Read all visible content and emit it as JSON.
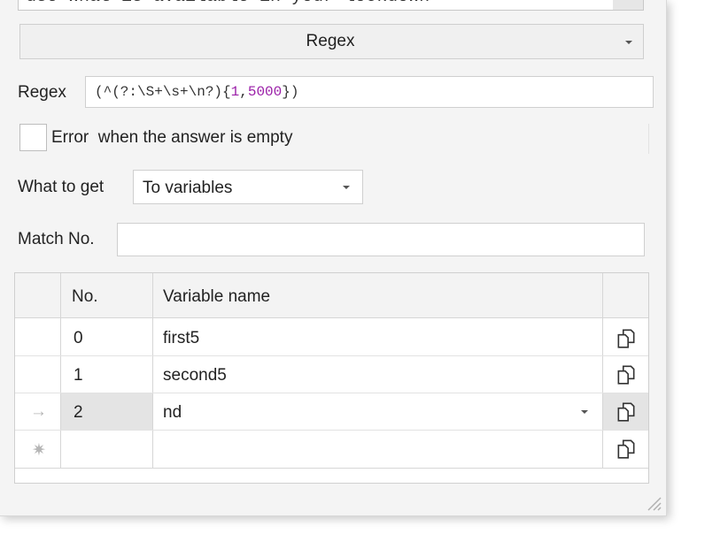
{
  "top_textbox": {
    "value": "use what is available in your lockdown"
  },
  "mode_dropdown": {
    "value": "Regex"
  },
  "regex": {
    "label": "Regex",
    "value_open": "(^(?:\\S+\\s+\\n?){",
    "value_num1": "1",
    "value_comma": ",",
    "value_num2": "5000",
    "value_close": "})",
    "colors": {
      "text": "#333333",
      "number": "#9b1fa8"
    }
  },
  "error_checkbox": {
    "label": "Error  when the answer is empty",
    "checked": false
  },
  "what_to_get": {
    "label": "What to get",
    "value": "To variables"
  },
  "match_no": {
    "label": "Match No.",
    "value": ""
  },
  "table": {
    "columns": [
      "No.",
      "Variable name"
    ],
    "rows": [
      {
        "no": "0",
        "name": "first5"
      },
      {
        "no": "1",
        "name": "second5"
      },
      {
        "no": "2",
        "name": "nd"
      },
      {
        "no": "",
        "name": ""
      }
    ],
    "current_row_marker": "→",
    "new_row_marker": "✷"
  }
}
